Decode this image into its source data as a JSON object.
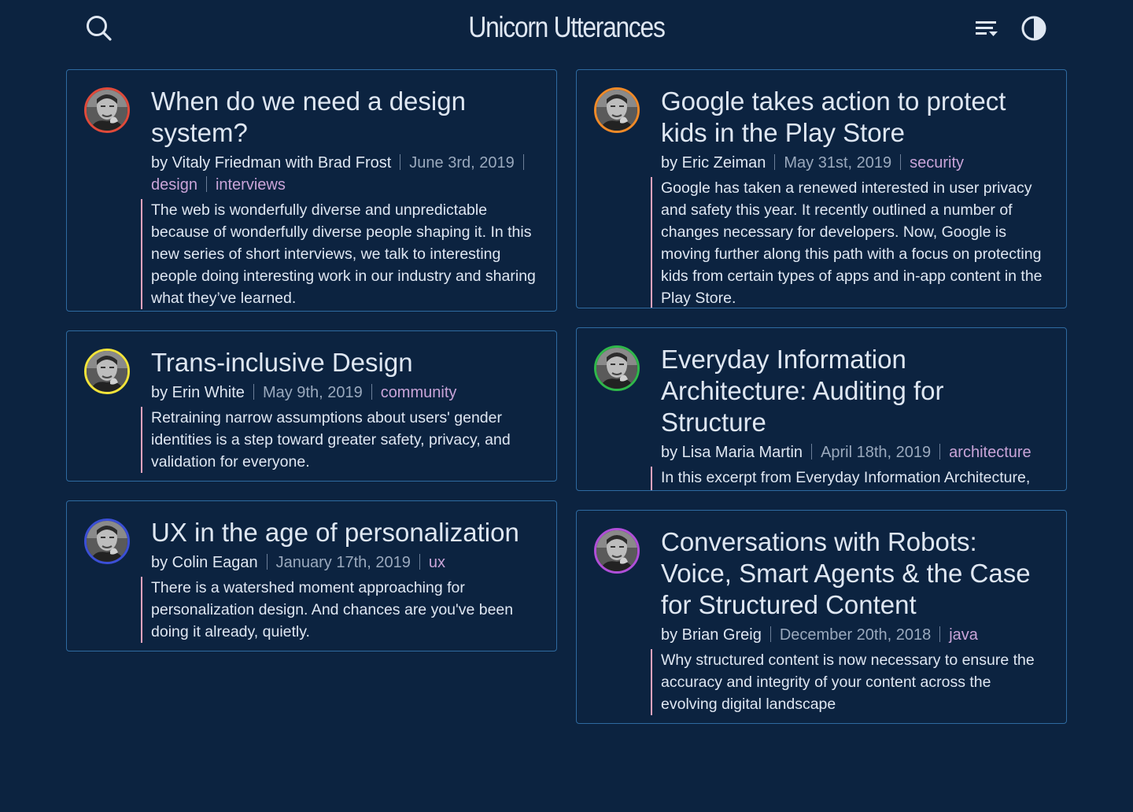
{
  "site": {
    "title": "Unicorn Utterances"
  },
  "header": {
    "search_icon": "search-icon",
    "filter_icon": "filter-icon",
    "theme_icon": "dark-mode-icon"
  },
  "posts": [
    {
      "title": "When do we need a design system?",
      "byline": "by Vitaly Friedman with Brad Frost",
      "date": "June 3rd, 2019",
      "tags": [
        "design",
        "interviews"
      ],
      "excerpt": "The web is wonderfully diverse and unpredictable because of wonderfully diverse people shaping it. In this new series of short interviews, we talk to interesting people doing interesting work in our industry and sharing what they’ve learned.",
      "ring_color": "#e04a3a"
    },
    {
      "title": "Trans-inclusive Design",
      "byline": "by Erin White",
      "date": "May 9th, 2019",
      "tags": [
        "community"
      ],
      "excerpt": "Retraining narrow assumptions about users' gender identities is a step toward greater safety, privacy, and validation for everyone.",
      "ring_color": "#f2e33a"
    },
    {
      "title": "UX in the age of personalization",
      "byline": "by Colin Eagan",
      "date": "January 17th, 2019",
      "tags": [
        "ux"
      ],
      "excerpt": "There is a watershed moment approaching for personalization design. And chances are you've been doing it already, quietly.",
      "ring_color": "#3b4fd6"
    },
    {
      "title": "Google takes action to protect kids in the Play Store",
      "byline": "by Eric Zeiman",
      "date": "May 31st, 2019",
      "tags": [
        "security"
      ],
      "excerpt": "Google has taken a renewed interested in user privacy and safety this year. It recently outlined a number of changes necessary for developers. Now, Google is moving further along this path with a focus on protecting kids from certain types of apps and in-app content in the Play Store.",
      "ring_color": "#f08a28"
    },
    {
      "title": "Everyday Information Architecture: Auditing for Structure",
      "byline": "by Lisa Maria Martin",
      "date": "April 18th, 2019",
      "tags": [
        "architecture"
      ],
      "excerpt": "In this excerpt from Everyday Information Architecture, Lisa Maria Martin introduces the structural audit.",
      "ring_color": "#2fb84a"
    },
    {
      "title": "Conversations with Robots: Voice, Smart Agents & the Case for Structured Content",
      "byline": "by Brian Greig",
      "date": "December 20th, 2018",
      "tags": [
        "java"
      ],
      "excerpt": "Why structured content is now necessary to ensure the accuracy and integrity of your content across the evolving digital landscape",
      "ring_color": "#b04fd8"
    }
  ]
}
